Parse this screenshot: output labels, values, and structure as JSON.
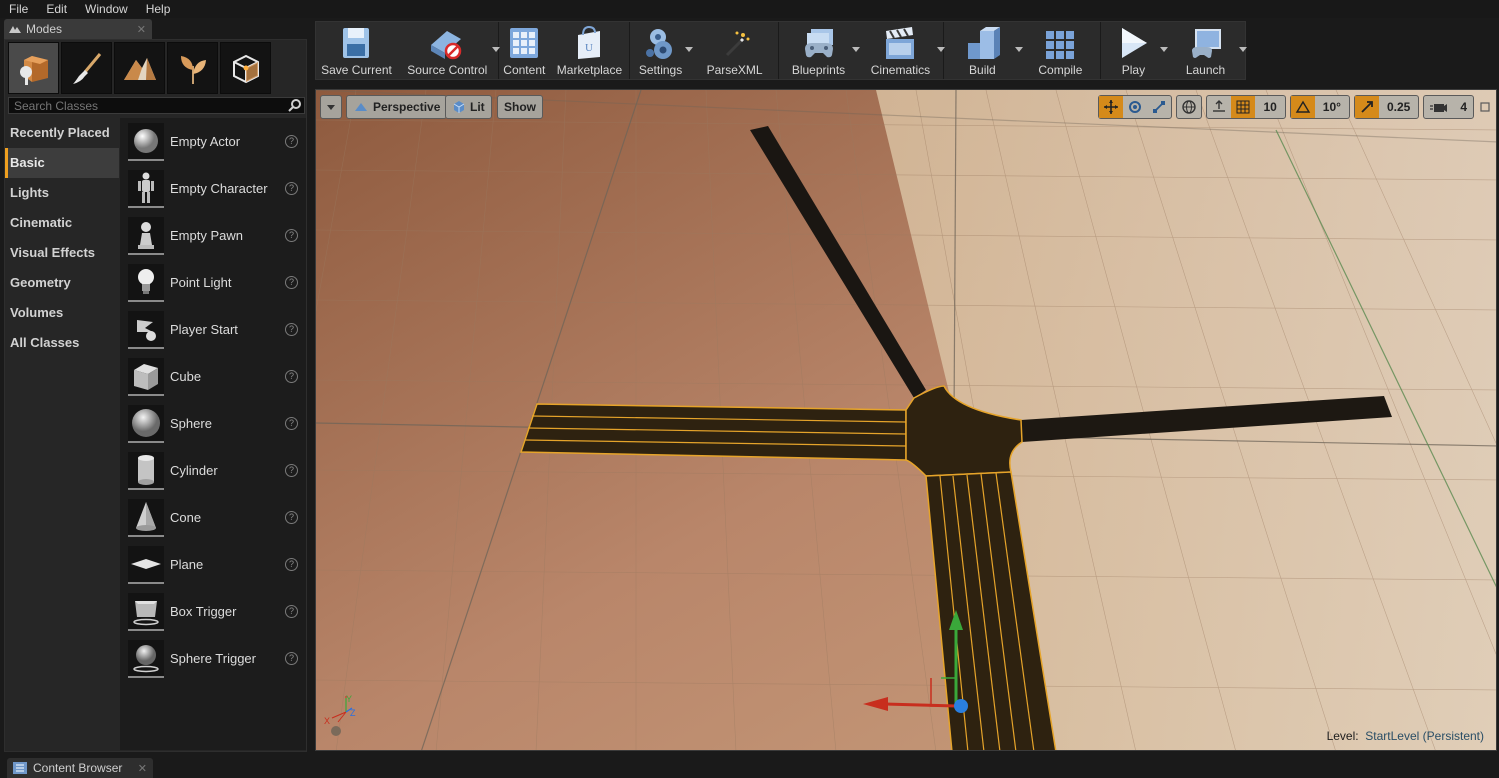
{
  "menu": [
    "File",
    "Edit",
    "Window",
    "Help"
  ],
  "modes": {
    "tab_title": "Modes",
    "mode_buttons": [
      "place-mode",
      "paint-mode",
      "landscape-mode",
      "foliage-mode",
      "geometry-mode"
    ],
    "search_placeholder": "Search Classes",
    "categories": [
      "Recently Placed",
      "Basic",
      "Lights",
      "Cinematic",
      "Visual Effects",
      "Geometry",
      "Volumes",
      "All Classes"
    ],
    "active_category": "Basic",
    "items": [
      "Empty Actor",
      "Empty Character",
      "Empty Pawn",
      "Point Light",
      "Player Start",
      "Cube",
      "Sphere",
      "Cylinder",
      "Cone",
      "Plane",
      "Box Trigger",
      "Sphere Trigger"
    ],
    "help_glyph": "?"
  },
  "toolbar": {
    "buttons": [
      {
        "label": "Save Current",
        "icon": "save-icon",
        "dropdown": false
      },
      {
        "label": "Source Control",
        "icon": "source-control-icon",
        "dropdown": true
      },
      {
        "label": "Content",
        "icon": "content-icon",
        "dropdown": false
      },
      {
        "label": "Marketplace",
        "icon": "marketplace-icon",
        "dropdown": false
      },
      {
        "label": "Settings",
        "icon": "settings-icon",
        "dropdown": true
      },
      {
        "label": "ParseXML",
        "icon": "parsexml-icon",
        "dropdown": false
      },
      {
        "label": "Blueprints",
        "icon": "blueprints-icon",
        "dropdown": true
      },
      {
        "label": "Cinematics",
        "icon": "cinematics-icon",
        "dropdown": true
      },
      {
        "label": "Build",
        "icon": "build-icon",
        "dropdown": true
      },
      {
        "label": "Compile",
        "icon": "compile-icon",
        "dropdown": false
      },
      {
        "label": "Play",
        "icon": "play-icon",
        "dropdown": true
      },
      {
        "label": "Launch",
        "icon": "launch-icon",
        "dropdown": true
      }
    ]
  },
  "viewport": {
    "perspective_label": "Perspective",
    "lit_label": "Lit",
    "show_label": "Show",
    "grid_snap": "10",
    "rotation_snap": "10°",
    "scale_snap": "0.25",
    "camera_speed": "4",
    "level_prefix": "Level:",
    "level_name": "StartLevel (Persistent)",
    "axis_labels": {
      "x": "X",
      "y": "Y",
      "z": "Z"
    }
  },
  "content_browser": {
    "tab_title": "Content Browser"
  },
  "colors": {
    "accent": "#f0a020",
    "road": "#2a1f10",
    "road_edge": "#e8a830",
    "floor_left": "#b07c5c",
    "floor_right": "#dccbb2"
  }
}
